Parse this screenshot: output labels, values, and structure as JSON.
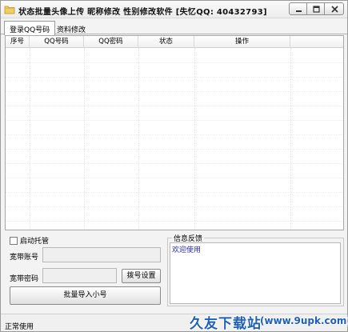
{
  "window": {
    "title": "状态批量头像上传  昵称修改  性别修改软件 [失忆QQ: 40432793]",
    "icon": "folder-icon"
  },
  "tabs": [
    {
      "label": "登录QQ号码",
      "active": true
    },
    {
      "label": "资料修改",
      "active": false
    }
  ],
  "table": {
    "columns": [
      "序号",
      "QQ号码",
      "QQ密码",
      "状态",
      "操作"
    ],
    "rows": []
  },
  "controls": {
    "auto_hosting_label": "启动托管",
    "auto_hosting_checked": false,
    "broadband_account_label": "宽带账号",
    "broadband_account_value": "",
    "broadband_password_label": "宽带密码",
    "broadband_password_value": "",
    "dial_settings_button": "拨号设置",
    "batch_import_button": "批量导入小号"
  },
  "info": {
    "title": "信息反馈",
    "text": "欢迎使用"
  },
  "status": {
    "text": "正常使用"
  },
  "watermark": {
    "site_name": "久友下载站",
    "url": "(www.9upk.com)"
  }
}
